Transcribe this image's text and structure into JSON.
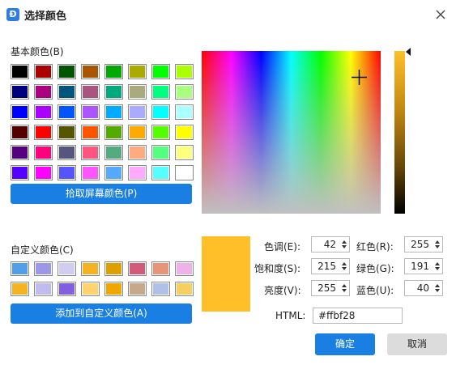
{
  "window": {
    "title": "选择颜色",
    "app_icon": "wps-icon",
    "close_icon": "close-icon"
  },
  "basic_colors": {
    "label": "基本颜色(B)",
    "swatches": [
      "#000000",
      "#aa0000",
      "#005500",
      "#aa5500",
      "#00aa00",
      "#aaaa00",
      "#00ff00",
      "#aaff00",
      "#00007f",
      "#aa007f",
      "#00557f",
      "#aa557f",
      "#00aa7f",
      "#aaaa7f",
      "#00ff7f",
      "#aaff7f",
      "#0000ff",
      "#aa00ff",
      "#0055ff",
      "#aa55ff",
      "#00aaff",
      "#aaaaff",
      "#00ffff",
      "#aaffff",
      "#550000",
      "#ff0000",
      "#555500",
      "#ff5500",
      "#55aa00",
      "#ffaa00",
      "#55ff00",
      "#ffff00",
      "#55007f",
      "#ff007f",
      "#55557f",
      "#ff557f",
      "#55aa7f",
      "#ffaa7f",
      "#55ff7f",
      "#ffff7f",
      "#5500ff",
      "#ff00ff",
      "#5555ff",
      "#ff55ff",
      "#55aaff",
      "#ffaaff",
      "#55ffff",
      "#ffffff"
    ]
  },
  "pick_screen_button": "拾取屏幕颜色(P)",
  "custom_colors": {
    "label": "自定义颜色(C)",
    "swatches": [
      "#4fa0e8",
      "#9b98e8",
      "#d0ccf2",
      "#f5b324",
      "#dea000",
      "#d45a7c",
      "#e89478",
      "#f0b0e8",
      "#f5b324",
      "#c0bcee",
      "#8060e0",
      "#ffd470",
      "#f0a800",
      "#c8a88a",
      "#b0c0e8",
      "#f5d060"
    ]
  },
  "add_custom_button": "添加到自定义颜色(A)",
  "preview_color": "#ffbf28",
  "fields": {
    "hue": {
      "label": "色调(E):",
      "value": "42"
    },
    "saturation": {
      "label": "饱和度(S):",
      "value": "215"
    },
    "lightness": {
      "label": "亮度(V):",
      "value": "255"
    },
    "red": {
      "label": "红色(R):",
      "value": "255"
    },
    "green": {
      "label": "绿色(G):",
      "value": "191"
    },
    "blue": {
      "label": "蓝色(U):",
      "value": "40"
    }
  },
  "html": {
    "label": "HTML:",
    "value": "#ffbf28"
  },
  "ok_button": "确定",
  "cancel_button": "取消"
}
